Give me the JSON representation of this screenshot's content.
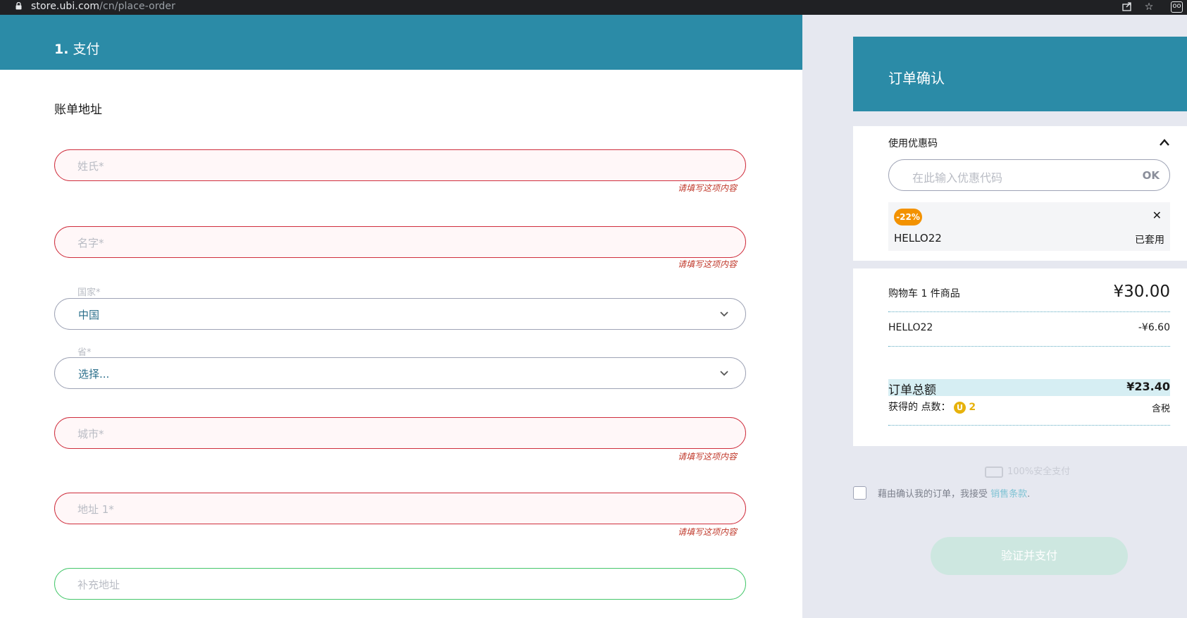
{
  "browser": {
    "url_domain": "store.ubi.com",
    "url_path": "/cn/place-order"
  },
  "checkout": {
    "step_number": "1.",
    "step_title": "支付",
    "billing_section": "账单地址",
    "error_message": "请填写这项内容",
    "fields": {
      "last_name_placeholder": "姓氏*",
      "first_name_placeholder": "名字*",
      "country_label": "国家*",
      "country_value": "中国",
      "province_label": "省*",
      "province_value": "选择...",
      "city_placeholder": "城市*",
      "address1_placeholder": "地址 1*",
      "address2_placeholder": "补充地址"
    }
  },
  "order": {
    "title": "订单确认",
    "promo": {
      "label": "使用优惠码",
      "input_placeholder": "在此输入优惠代码",
      "ok_label": "OK",
      "badge": "-22%",
      "code": "HELLO22",
      "status": "已套用"
    },
    "summary": {
      "cart_label": "购物车 1 件商品",
      "cart_price": "¥30.00",
      "discount_label": "HELLO22",
      "discount_value": "-¥6.60",
      "total_label": "订单总额",
      "total_value": "¥23.40",
      "points_label": "获得的 点数：",
      "points_value": "2",
      "tax_note": "含税"
    },
    "secure_text": "100%安全支付",
    "terms_text": "藉由确认我的订单，我接受",
    "terms_link": "销售条款",
    "terms_suffix": ".",
    "pay_button": "验证并支付"
  },
  "colors": {
    "brand": "#2b8ba7",
    "error": "#cf2e3d",
    "valid": "#45c76b",
    "promo_badge": "#f39200",
    "points_coin": "#e7b20c"
  }
}
